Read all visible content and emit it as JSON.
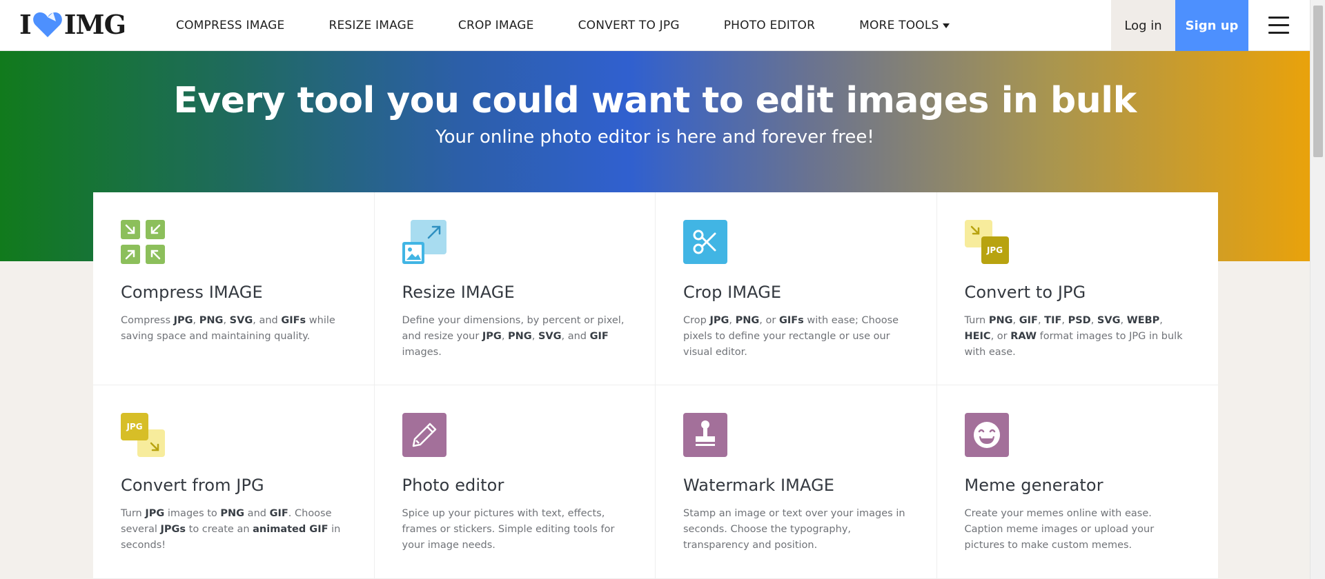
{
  "brand": {
    "logo_text_left": "I",
    "logo_text_right": "IMG"
  },
  "nav": {
    "items": [
      "COMPRESS IMAGE",
      "RESIZE IMAGE",
      "CROP IMAGE",
      "CONVERT TO JPG",
      "PHOTO EDITOR",
      "MORE TOOLS"
    ],
    "login": "Log in",
    "signup": "Sign up"
  },
  "hero": {
    "title": "Every tool you could want to edit images in bulk",
    "subtitle": "Your online photo editor is here and forever free!"
  },
  "colors": {
    "accent_blue": "#4d90fe",
    "green": "#8cbf5b",
    "sky": "#41b5e4",
    "olive": "#b8a310",
    "yellow": "#d7be27",
    "mauve": "#a3709a"
  },
  "tools": [
    {
      "title": "Compress IMAGE",
      "icon": "compress-icon",
      "desc": [
        [
          "Compress ",
          false
        ],
        [
          "JPG",
          true
        ],
        [
          ", ",
          false
        ],
        [
          "PNG",
          true
        ],
        [
          ", ",
          false
        ],
        [
          "SVG",
          true
        ],
        [
          ", and ",
          false
        ],
        [
          "GIFs",
          true
        ],
        [
          " while saving space and maintaining quality.",
          false
        ]
      ]
    },
    {
      "title": "Resize IMAGE",
      "icon": "resize-icon",
      "desc": [
        [
          "Define your dimensions, by percent or pixel, and resize your ",
          false
        ],
        [
          "JPG",
          true
        ],
        [
          ", ",
          false
        ],
        [
          "PNG",
          true
        ],
        [
          ", ",
          false
        ],
        [
          "SVG",
          true
        ],
        [
          ", and ",
          false
        ],
        [
          "GIF",
          true
        ],
        [
          " images.",
          false
        ]
      ]
    },
    {
      "title": "Crop IMAGE",
      "icon": "scissors-icon",
      "desc": [
        [
          "Crop ",
          false
        ],
        [
          "JPG",
          true
        ],
        [
          ", ",
          false
        ],
        [
          "PNG",
          true
        ],
        [
          ", or ",
          false
        ],
        [
          "GIFs",
          true
        ],
        [
          " with ease; Choose pixels to define your rectangle or use our visual editor.",
          false
        ]
      ]
    },
    {
      "title": "Convert to JPG",
      "icon": "convert-to-jpg-icon",
      "badge": "JPG",
      "desc": [
        [
          "Turn ",
          false
        ],
        [
          "PNG",
          true
        ],
        [
          ", ",
          false
        ],
        [
          "GIF",
          true
        ],
        [
          ", ",
          false
        ],
        [
          "TIF",
          true
        ],
        [
          ", ",
          false
        ],
        [
          "PSD",
          true
        ],
        [
          ", ",
          false
        ],
        [
          "SVG",
          true
        ],
        [
          ", ",
          false
        ],
        [
          "WEBP",
          true
        ],
        [
          ", ",
          false
        ],
        [
          "HEIC",
          true
        ],
        [
          ", or ",
          false
        ],
        [
          "RAW",
          true
        ],
        [
          " format images to JPG in bulk with ease.",
          false
        ]
      ]
    },
    {
      "title": "Convert from JPG",
      "icon": "convert-from-jpg-icon",
      "badge": "JPG",
      "desc": [
        [
          "Turn ",
          false
        ],
        [
          "JPG",
          true
        ],
        [
          " images to ",
          false
        ],
        [
          "PNG",
          true
        ],
        [
          " and ",
          false
        ],
        [
          "GIF",
          true
        ],
        [
          ". Choose several ",
          false
        ],
        [
          "JPGs",
          true
        ],
        [
          " to create an ",
          false
        ],
        [
          "animated GIF",
          true
        ],
        [
          " in seconds!",
          false
        ]
      ]
    },
    {
      "title": "Photo editor",
      "icon": "pencil-icon",
      "desc": [
        [
          "Spice up your pictures with text, effects, frames or stickers. Simple editing tools for your image needs.",
          false
        ]
      ]
    },
    {
      "title": "Watermark IMAGE",
      "icon": "stamp-icon",
      "desc": [
        [
          "Stamp an image or text over your images in seconds. Choose the typography, transparency and position.",
          false
        ]
      ]
    },
    {
      "title": "Meme generator",
      "icon": "laughing-face-icon",
      "desc": [
        [
          "Create your memes online with ease. Caption meme images or upload your pictures to make custom memes.",
          false
        ]
      ]
    }
  ]
}
